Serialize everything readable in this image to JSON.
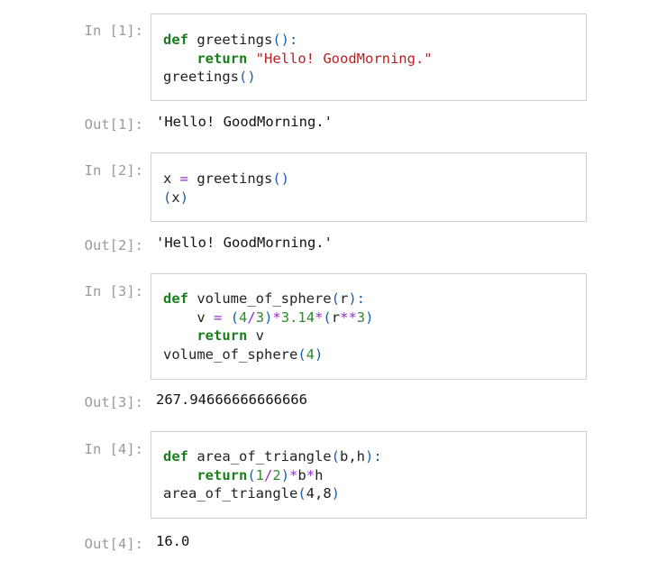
{
  "cells": [
    {
      "in_prompt": "In [1]:",
      "code": [
        [
          {
            "t": "def",
            "c": "kw"
          },
          {
            "t": " greetings"
          },
          {
            "t": "():",
            "c": "par"
          }
        ],
        [
          {
            "t": "    "
          },
          {
            "t": "return",
            "c": "kw"
          },
          {
            "t": " "
          },
          {
            "t": "\"Hello! GoodMorning.\"",
            "c": "str"
          }
        ],
        [
          {
            "t": "greetings"
          },
          {
            "t": "()",
            "c": "par"
          }
        ]
      ],
      "out_prompt": "Out[1]:",
      "output": "'Hello! GoodMorning.'"
    },
    {
      "in_prompt": "In [2]:",
      "code": [
        [
          {
            "t": "x "
          },
          {
            "t": "=",
            "c": "op"
          },
          {
            "t": " greetings"
          },
          {
            "t": "()",
            "c": "par"
          }
        ],
        [
          {
            "t": "(",
            "c": "par"
          },
          {
            "t": "x"
          },
          {
            "t": ")",
            "c": "par"
          }
        ]
      ],
      "out_prompt": "Out[2]:",
      "output": "'Hello! GoodMorning.'"
    },
    {
      "in_prompt": "In [3]:",
      "code": [
        [
          {
            "t": "def",
            "c": "kw"
          },
          {
            "t": " volume_of_sphere"
          },
          {
            "t": "(",
            "c": "par"
          },
          {
            "t": "r"
          },
          {
            "t": "):",
            "c": "par"
          }
        ],
        [
          {
            "t": "    v "
          },
          {
            "t": "=",
            "c": "op"
          },
          {
            "t": " "
          },
          {
            "t": "(",
            "c": "par"
          },
          {
            "t": "4",
            "c": "num"
          },
          {
            "t": "/",
            "c": "op"
          },
          {
            "t": "3",
            "c": "num"
          },
          {
            "t": ")",
            "c": "par"
          },
          {
            "t": "*",
            "c": "op"
          },
          {
            "t": "3.14",
            "c": "num"
          },
          {
            "t": "*",
            "c": "op"
          },
          {
            "t": "(",
            "c": "par"
          },
          {
            "t": "r"
          },
          {
            "t": "**",
            "c": "op"
          },
          {
            "t": "3",
            "c": "num"
          },
          {
            "t": ")",
            "c": "par"
          }
        ],
        [
          {
            "t": "    "
          },
          {
            "t": "return",
            "c": "kw"
          },
          {
            "t": " v"
          }
        ],
        [
          {
            "t": "volume_of_sphere"
          },
          {
            "t": "(",
            "c": "par"
          },
          {
            "t": "4",
            "c": "num"
          },
          {
            "t": ")",
            "c": "par"
          }
        ]
      ],
      "out_prompt": "Out[3]:",
      "output": "267.94666666666666"
    },
    {
      "in_prompt": "In [4]:",
      "code": [
        [
          {
            "t": "def",
            "c": "kw"
          },
          {
            "t": " area_of_triangle"
          },
          {
            "t": "(",
            "c": "par"
          },
          {
            "t": "b,h"
          },
          {
            "t": "):",
            "c": "par"
          }
        ],
        [
          {
            "t": "    "
          },
          {
            "t": "return",
            "c": "kw"
          },
          {
            "t": "(",
            "c": "par"
          },
          {
            "t": "1",
            "c": "num"
          },
          {
            "t": "/",
            "c": "op"
          },
          {
            "t": "2",
            "c": "num"
          },
          {
            "t": ")",
            "c": "par"
          },
          {
            "t": "*",
            "c": "op"
          },
          {
            "t": "b"
          },
          {
            "t": "*",
            "c": "op"
          },
          {
            "t": "h"
          }
        ],
        [
          {
            "t": "area_of_triangle"
          },
          {
            "t": "(",
            "c": "par"
          },
          {
            "t": "4,8"
          },
          {
            "t": ")",
            "c": "par"
          }
        ]
      ],
      "out_prompt": "Out[4]:",
      "output": "16.0"
    }
  ]
}
